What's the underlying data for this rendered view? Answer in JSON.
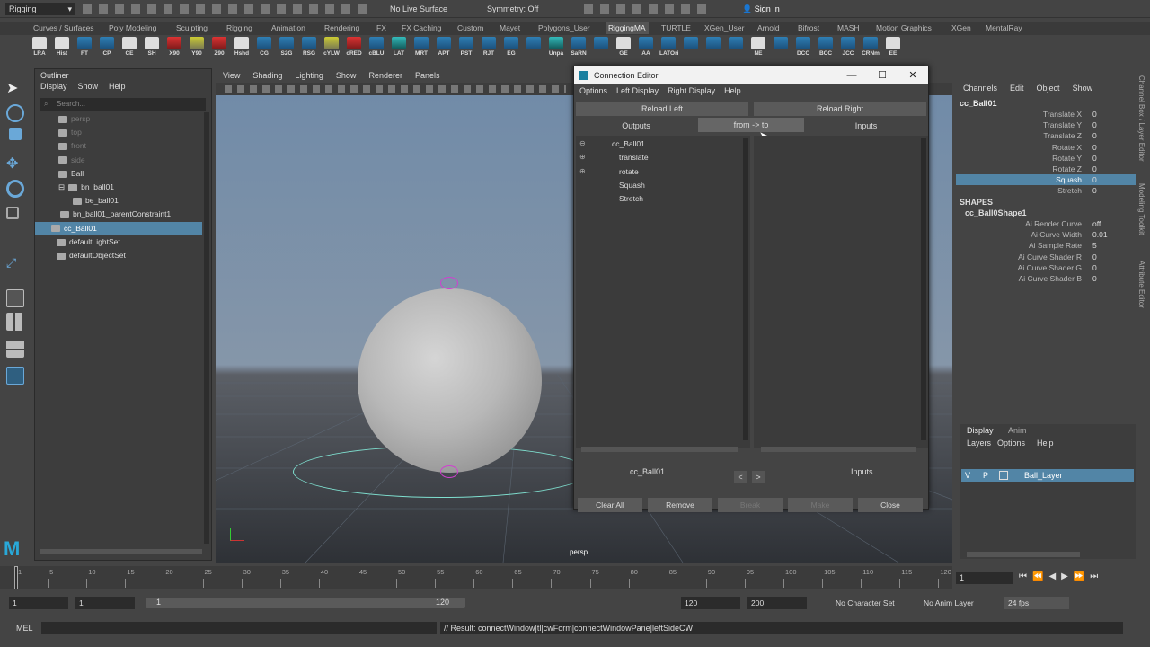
{
  "status_line": {
    "mode_dropdown": "Rigging",
    "live_surface": "No Live Surface",
    "symmetry": "Symmetry: Off",
    "sign_in": "Sign In"
  },
  "shelf_tabs": [
    "Curves / Surfaces",
    "Poly Modeling",
    "Sculpting",
    "Rigging",
    "Animation",
    "Rendering",
    "FX",
    "FX Caching",
    "Custom",
    "Mayet",
    "Polygons_User",
    "RiggingMA",
    "TURTLE",
    "XGen_User",
    "Arnold",
    "Bifrost",
    "MASH",
    "Motion Graphics",
    "XGen",
    "MentalRay"
  ],
  "shelf_active": "RiggingMA",
  "shelf_icons": [
    "LRA",
    "Hist",
    "FT",
    "CP",
    "CE",
    "SH",
    "X90",
    "Y90",
    "Z90",
    "Hshd",
    "CG",
    "S2G",
    "RSG",
    "cYLW",
    "cRED",
    "cBLU",
    "LAT",
    "MRT",
    "APT",
    "PST",
    "RJT",
    "EG",
    "",
    "Unpa",
    "SaRN",
    "",
    "GE",
    "AA",
    "LATOri",
    "",
    "",
    "",
    "NE",
    "",
    "DCC",
    "BCC",
    "JCC",
    "CRNm",
    "EE"
  ],
  "outliner": {
    "title": "Outliner",
    "menu": [
      "Display",
      "Show",
      "Help"
    ],
    "search_placeholder": "Search...",
    "rows": [
      {
        "label": "persp",
        "dim": true
      },
      {
        "label": "top",
        "dim": true
      },
      {
        "label": "front",
        "dim": true
      },
      {
        "label": "side",
        "dim": true
      },
      {
        "label": "Ball",
        "dim": false
      },
      {
        "label": "bn_ball01",
        "dim": false
      },
      {
        "label": "be_ball01",
        "dim": false
      },
      {
        "label": "bn_ball01_parentConstraint1",
        "dim": false
      },
      {
        "label": "cc_Ball01",
        "dim": false,
        "selected": true
      },
      {
        "label": "defaultLightSet",
        "dim": false
      },
      {
        "label": "defaultObjectSet",
        "dim": false
      }
    ]
  },
  "viewport": {
    "menu": [
      "View",
      "Shading",
      "Lighting",
      "Show",
      "Renderer",
      "Panels"
    ],
    "camera_label": "persp"
  },
  "connection_editor": {
    "title": "Connection Editor",
    "menu": [
      "Options",
      "Left Display",
      "Right Display",
      "Help"
    ],
    "reload_left": "Reload Left",
    "reload_right": "Reload Right",
    "outputs": "Outputs",
    "direction": "from -> to",
    "inputs": "Inputs",
    "left_items": [
      {
        "label": "cc_Ball01",
        "expander": "⊖"
      },
      {
        "label": "translate",
        "expander": "⊕"
      },
      {
        "label": "rotate",
        "expander": "⊕"
      },
      {
        "label": "Squash",
        "expander": ""
      },
      {
        "label": "Stretch",
        "expander": ""
      }
    ],
    "left_node": "cc_Ball01",
    "right_node": "Inputs",
    "buttons": [
      "Clear All",
      "Remove",
      "Break",
      "Make",
      "Close"
    ]
  },
  "channel_box": {
    "menu": [
      "Channels",
      "Edit",
      "Object",
      "Show"
    ],
    "node": "cc_Ball01",
    "attributes": [
      {
        "name": "Translate X",
        "value": "0"
      },
      {
        "name": "Translate Y",
        "value": "0"
      },
      {
        "name": "Translate Z",
        "value": "0"
      },
      {
        "name": "Rotate X",
        "value": "0"
      },
      {
        "name": "Rotate Y",
        "value": "0"
      },
      {
        "name": "Rotate Z",
        "value": "0"
      },
      {
        "name": "Squash",
        "value": "0",
        "selected": true
      },
      {
        "name": "Stretch",
        "value": "0"
      }
    ],
    "shapes_header": "SHAPES",
    "shape_node": "cc_Ball0Shape1",
    "shape_attributes": [
      {
        "name": "Ai Render Curve",
        "value": "off"
      },
      {
        "name": "Ai Curve Width",
        "value": "0.01"
      },
      {
        "name": "Ai Sample Rate",
        "value": "5"
      },
      {
        "name": "Ai Curve Shader R",
        "value": "0"
      },
      {
        "name": "Ai Curve Shader G",
        "value": "0"
      },
      {
        "name": "Ai Curve Shader B",
        "value": "0"
      }
    ]
  },
  "side_tabs": [
    "Channel Box / Layer Editor",
    "Modeling Toolkit",
    "Attribute Editor"
  ],
  "layers": {
    "tabs": [
      "Display",
      "Anim"
    ],
    "menu": [
      "Layers",
      "Options",
      "Help"
    ],
    "layer": {
      "v": "V",
      "p": "P",
      "name": "Ball_Layer"
    }
  },
  "timeline": {
    "ticks": [
      "1",
      "5",
      "10",
      "15",
      "20",
      "25",
      "30",
      "35",
      "40",
      "45",
      "50",
      "55",
      "60",
      "65",
      "70",
      "75",
      "80",
      "85",
      "90",
      "95",
      "100",
      "105",
      "110",
      "115",
      "120"
    ],
    "current_frame": "1"
  },
  "range": {
    "start": "1",
    "anim_start": "1",
    "slider_start": "1",
    "slider_end": "120",
    "anim_end": "120",
    "end": "200",
    "character_set": "No Character Set",
    "anim_layer": "No Anim Layer",
    "fps": "24 fps"
  },
  "command": {
    "lang": "MEL",
    "result": "// Result: connectWindow|tl|cwForm|connectWindowPane|leftSideCW"
  }
}
